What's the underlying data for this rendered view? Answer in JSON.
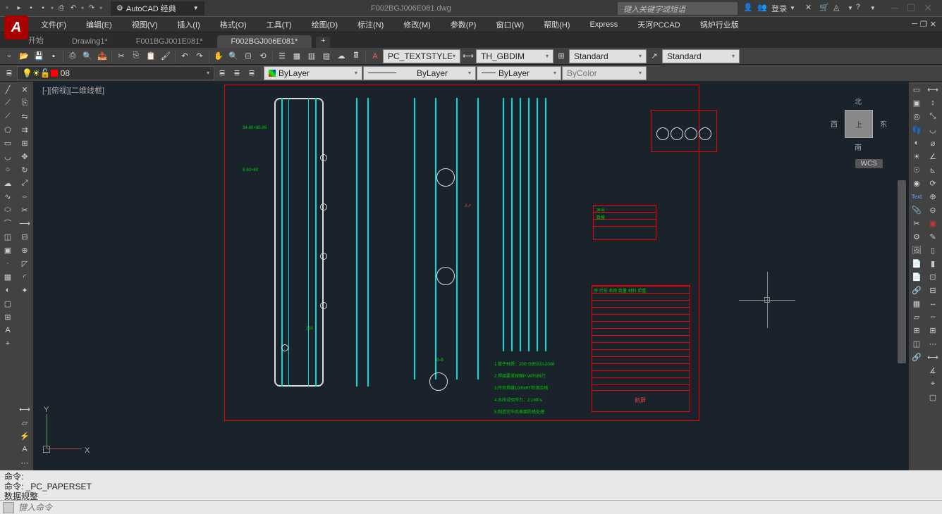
{
  "title": "F002BGJ006E081.dwg",
  "workspace": "AutoCAD 经典",
  "search_placeholder": "键入关键字或短语",
  "login_label": "登录",
  "menus": [
    "文件(F)",
    "编辑(E)",
    "视图(V)",
    "插入(I)",
    "格式(O)",
    "工具(T)",
    "绘图(D)",
    "标注(N)",
    "修改(M)",
    "参数(P)",
    "窗口(W)",
    "帮助(H)",
    "Express",
    "天河PCCAD",
    "锅炉行业版"
  ],
  "tabs": [
    {
      "label": "开始",
      "active": false
    },
    {
      "label": "Drawing1*",
      "active": false
    },
    {
      "label": "F001BGJ001E081*",
      "active": false
    },
    {
      "label": "F002BGJ006E081*",
      "active": true
    }
  ],
  "styles": {
    "text_style": "PC_TEXTSTYLE",
    "dim_style": "TH_GBDIM",
    "table_style": "Standard",
    "mleader_style": "Standard"
  },
  "layer": {
    "current": "08",
    "bylayer1": "ByLayer",
    "bylayer2": "ByLayer",
    "bylayer3": "ByLayer",
    "bycolor": "ByColor"
  },
  "viewport_label": "[-][俯视][二维线框]",
  "nav": {
    "north": "北",
    "south": "南",
    "east": "东",
    "west": "西",
    "top": "上"
  },
  "wcs": "WCS",
  "ucs": {
    "x": "X",
    "y": "Y"
  },
  "command_lines": [
    "命令:",
    "命令: _PC_PAPERSET",
    "数据规整"
  ],
  "command_placeholder": "键入命令",
  "icons": {
    "new": "▢",
    "open": "📂",
    "save": "💾",
    "print": "🖨",
    "undo": "↶",
    "redo": "↷",
    "line": "╱",
    "circle": "○",
    "arc": "◡",
    "rect": "▭",
    "poly": "⬠",
    "text": "A",
    "move": "✥",
    "copy": "⎘",
    "rotate": "↻",
    "mirror": "⇋",
    "trim": "✂",
    "erase": "✕",
    "layer": "≣",
    "dim": "⟷",
    "hatch": "▦",
    "block": "◫"
  }
}
